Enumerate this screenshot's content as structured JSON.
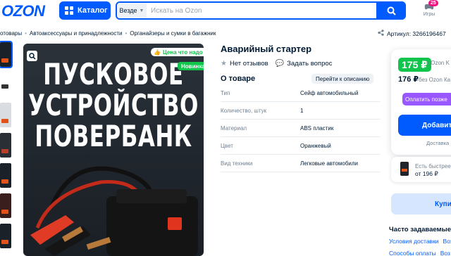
{
  "header": {
    "logo": "OZON",
    "catalog_label": "Каталог",
    "search_scope": "Везде",
    "search_placeholder": "Искать на Ozon",
    "games_badge": "25",
    "games_label": "Игры"
  },
  "breadcrumb": [
    "отовары",
    "Автоаксессуары и принадлежности",
    "Органайзеры и сумки в багажник"
  ],
  "article": "Артикул: 3266196467",
  "gallery": {
    "image_title_lines": [
      "ПУСКОВОЕ",
      "УСТРОЙСТВО",
      "ПОВЕРБАНК"
    ],
    "tag_price": "Цена что надо",
    "tag_new": "Новинка"
  },
  "product": {
    "title": "Аварийный стартер",
    "reviews": "Нет отзывов",
    "question": "Задать вопрос",
    "about": "О товаре",
    "description_link": "Перейти к описанию",
    "specs": [
      {
        "key": "Тип",
        "value": "Сейф автомобильный"
      },
      {
        "key": "Количество, штук",
        "value": "1"
      },
      {
        "key": "Материал",
        "value": "ABS пластик"
      },
      {
        "key": "Цвет",
        "value": "Оранжевый"
      },
      {
        "key": "Вид техники",
        "value": "Легковые автомобили"
      }
    ]
  },
  "buy_box": {
    "price_card": "175 ₽",
    "price_card_note": "c Ozon K",
    "price_regular": "176 ₽",
    "price_regular_note": "без Ozon Ка",
    "split_label": "Оплатить позже",
    "add_label": "Добавить",
    "delivery_label": "Доставка",
    "faster_line1": "Есть быстрее",
    "faster_line2": "от 196 ₽",
    "buy_now": "Купи"
  },
  "faq": {
    "title": "Часто задаваемые в",
    "row1": [
      "Условия доставки",
      "Воз"
    ],
    "row2": [
      "Способы оплаты",
      "Воз"
    ]
  },
  "colors": {
    "brand": "#005bff",
    "green": "#10c44c",
    "purple": "#9957ff",
    "badge": "#f1117e"
  }
}
